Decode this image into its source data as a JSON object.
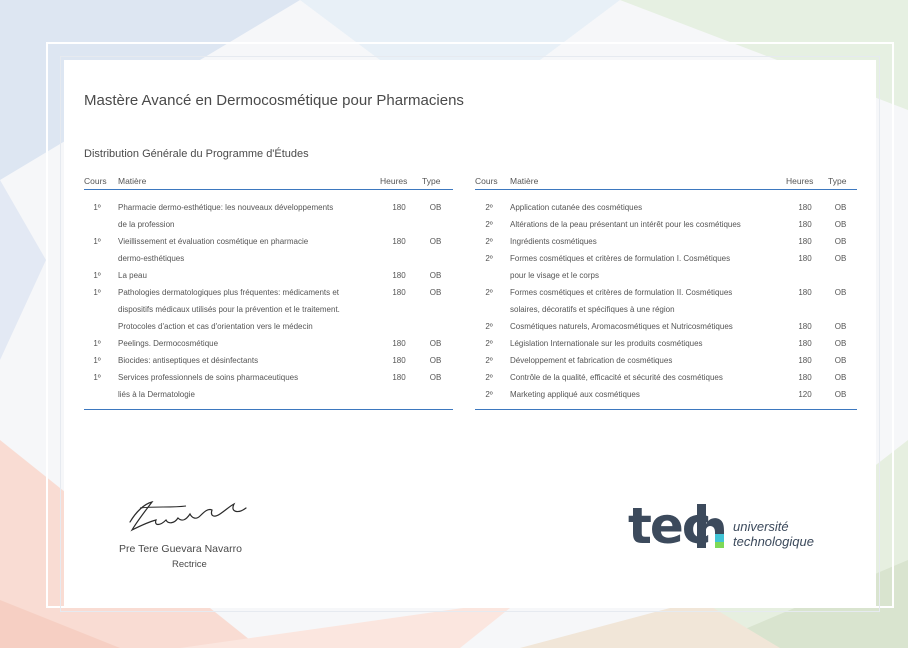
{
  "document": {
    "title": "Mastère Avancé en Dermocosmétique pour Pharmaciens",
    "subtitle": "Distribution Générale du Programme d'Études"
  },
  "table_headers": {
    "cours": "Cours",
    "matiere": "Matière",
    "heures": "Heures",
    "type": "Type"
  },
  "left_table": [
    {
      "cours": "1º",
      "matiere_lines": [
        "Pharmacie dermo-esthétique: les nouveaux développements",
        "de la profession"
      ],
      "heures": "180",
      "type": "OB"
    },
    {
      "cours": "1º",
      "matiere_lines": [
        "Vieillissement et évaluation cosmétique en pharmacie",
        "dermo-esthétiques"
      ],
      "heures": "180",
      "type": "OB"
    },
    {
      "cours": "1º",
      "matiere_lines": [
        "La peau"
      ],
      "heures": "180",
      "type": "OB"
    },
    {
      "cours": "1º",
      "matiere_lines": [
        "Pathologies dermatologiques plus fréquentes: médicaments et",
        "dispositifs médicaux utilisés pour la prévention et le traitement.",
        "Protocoles d'action et cas d'orientation vers le médecin"
      ],
      "heures": "180",
      "type": "OB"
    },
    {
      "cours": "1º",
      "matiere_lines": [
        "Peelings. Dermocosmétique"
      ],
      "heures": "180",
      "type": "OB"
    },
    {
      "cours": "1º",
      "matiere_lines": [
        "Biocides: antiseptiques et désinfectants"
      ],
      "heures": "180",
      "type": "OB"
    },
    {
      "cours": "1º",
      "matiere_lines": [
        "Services professionnels de soins pharmaceutiques",
        "liés à la Dermatologie"
      ],
      "heures": "180",
      "type": "OB"
    }
  ],
  "right_table": [
    {
      "cours": "2º",
      "matiere_lines": [
        "Application cutanée des cosmétiques"
      ],
      "heures": "180",
      "type": "OB"
    },
    {
      "cours": "2º",
      "matiere_lines": [
        "Altérations de la peau présentant un intérêt pour les cosmétiques"
      ],
      "heures": "180",
      "type": "OB"
    },
    {
      "cours": "2º",
      "matiere_lines": [
        "Ingrédients cosmétiques"
      ],
      "heures": "180",
      "type": "OB"
    },
    {
      "cours": "2º",
      "matiere_lines": [
        "Formes cosmétiques et critères de formulation I. Cosmétiques",
        "pour le visage et le corps"
      ],
      "heures": "180",
      "type": "OB"
    },
    {
      "cours": "2º",
      "matiere_lines": [
        "Formes cosmétiques et critères de formulation II. Cosmétiques",
        "solaires, décoratifs et spécifiques à une région"
      ],
      "heures": "180",
      "type": "OB"
    },
    {
      "cours": "2º",
      "matiere_lines": [
        "Cosmétiques naturels, Aromacosmétiques et Nutricosmétiques"
      ],
      "heures": "180",
      "type": "OB"
    },
    {
      "cours": "2º",
      "matiere_lines": [
        "Législation Internationale sur les produits cosmétiques"
      ],
      "heures": "180",
      "type": "OB"
    },
    {
      "cours": "2º",
      "matiere_lines": [
        "Développement et fabrication de cosmétiques"
      ],
      "heures": "180",
      "type": "OB"
    },
    {
      "cours": "2º",
      "matiere_lines": [
        "Contrôle de la qualité, efficacité et sécurité des cosmétiques"
      ],
      "heures": "180",
      "type": "OB"
    },
    {
      "cours": "2º",
      "matiere_lines": [
        "Marketing appliqué aux cosmétiques"
      ],
      "heures": "120",
      "type": "OB"
    }
  ],
  "signatory": {
    "name": "Pre Tere Guevara Navarro",
    "role": "Rectrice"
  },
  "logo": {
    "word": "tec",
    "letter_h": "h",
    "line1": "université",
    "line2": "technologique",
    "text_color": "#3c4a5c",
    "accent_color": "#41c4d6",
    "accent_color_2": "#7ed957"
  },
  "colors": {
    "rule": "#3d78bf"
  }
}
